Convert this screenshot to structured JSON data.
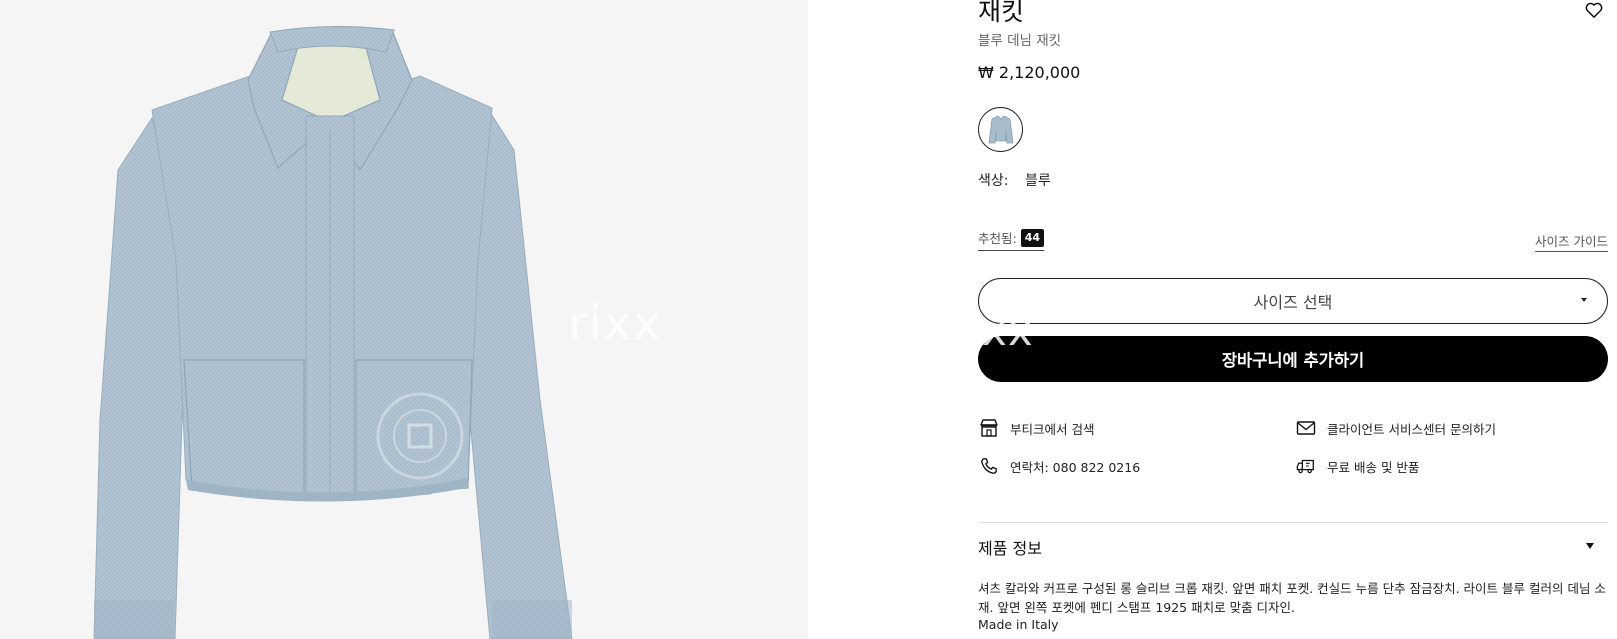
{
  "product": {
    "title": "재킷",
    "subtitle": "블루 데님 재킷",
    "price": "₩ 2,120,000",
    "image_watermark": "rixx",
    "overlay_watermark": "xx"
  },
  "color": {
    "label": "색상:",
    "value": "블루",
    "swatch_color": "#a9bccb"
  },
  "sizes": {
    "recommended_label": "추천됨:",
    "recommended_value": "44",
    "size_guide": "사이즈 가이드",
    "select_label": "사이즈 선택"
  },
  "actions": {
    "add_to_cart": "장바구니에 추가하기"
  },
  "services": [
    {
      "icon": "store-icon",
      "label": "부티크에서 검색"
    },
    {
      "icon": "mail-icon",
      "label": "클라이언트 서비스센터 문의하기"
    },
    {
      "icon": "phone-icon",
      "label": "연락처: 080 822 0216"
    },
    {
      "icon": "truck-icon",
      "label": "무료 배송 및 반품"
    }
  ],
  "product_info": {
    "title": "제품 정보",
    "description": "셔츠 칼라와 커프로 구성된 롱 슬리브 크롭 재킷. 앞면 패치 포켓. 컨실드 누름 단추 잠금장치. 라이트 블루 컬러의 데님 소재. 앞면 왼쪽 포켓에 펜디 스탬프 1925 패치로 맞춤 디자인.",
    "made_in": "Made in Italy"
  },
  "colors": {
    "accent": "#000000",
    "image_bg": "#f5f5f5",
    "denim": "#a7bccc"
  }
}
